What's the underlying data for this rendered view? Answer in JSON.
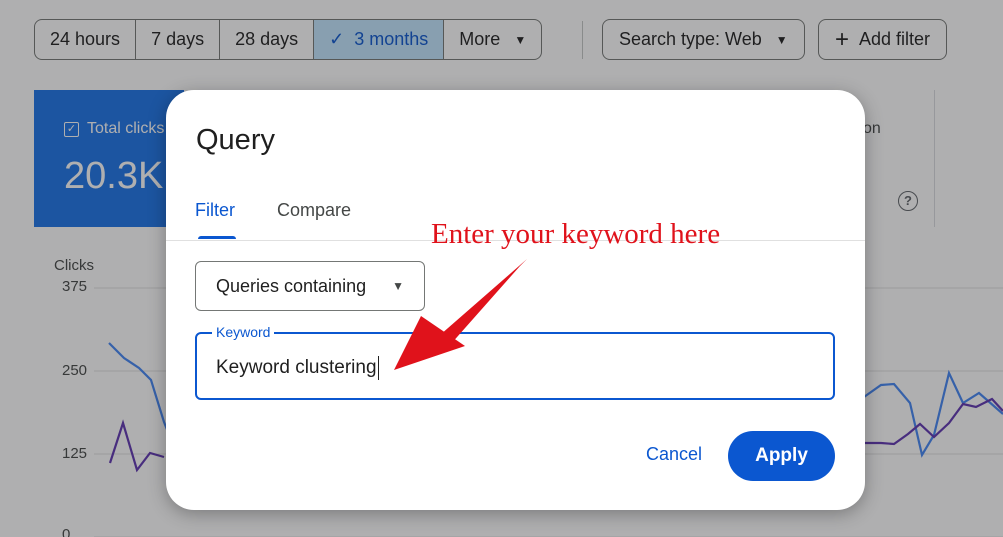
{
  "toolbar": {
    "date_ranges": [
      {
        "label": "24 hours",
        "selected": false
      },
      {
        "label": "7 days",
        "selected": false
      },
      {
        "label": "28 days",
        "selected": false
      },
      {
        "label": "3 months",
        "selected": true
      },
      {
        "label": "More",
        "selected": false,
        "has_dropdown": true
      }
    ],
    "search_type": "Search type: Web",
    "add_filter": "Add filter"
  },
  "metric_card": {
    "label": "Total clicks",
    "value": "20.3K",
    "checked": true,
    "color": "#1a73e8"
  },
  "side_card": {
    "label_fragment": "on"
  },
  "chart": {
    "axis_title": "Clicks",
    "y_ticks": [
      "375",
      "250",
      "125",
      "0"
    ],
    "series_colors": [
      "#4285f4",
      "#5e35b1"
    ]
  },
  "dialog": {
    "title": "Query",
    "tabs": [
      {
        "label": "Filter",
        "active": true
      },
      {
        "label": "Compare",
        "active": false
      }
    ],
    "match_type": "Queries containing",
    "keyword_label": "Keyword",
    "keyword_value": "Keyword clustering",
    "cancel": "Cancel",
    "apply": "Apply",
    "accent": "#0b57d0"
  },
  "annotation": {
    "text": "Enter your keyword here",
    "color": "#e0121b"
  }
}
